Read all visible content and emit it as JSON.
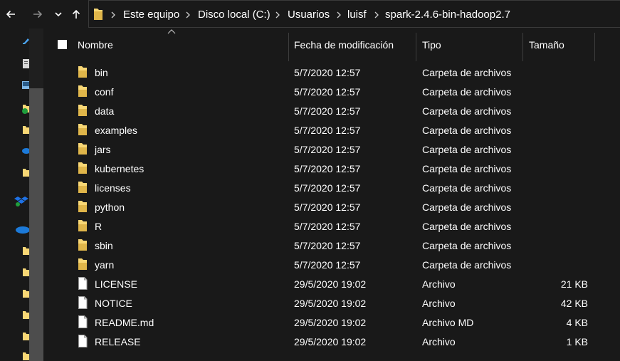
{
  "nav": {
    "back_icon": "arrow-left-icon",
    "forward_icon": "arrow-right-icon",
    "recent_icon": "chevron-down-icon",
    "up_icon": "arrow-up-icon"
  },
  "breadcrumb": [
    {
      "label": "Este equipo"
    },
    {
      "label": "Disco local (C:)"
    },
    {
      "label": "Usuarios"
    },
    {
      "label": "luisf"
    },
    {
      "label": "spark-2.4.6-bin-hadoop2.7"
    }
  ],
  "columns": {
    "name": "Nombre",
    "date": "Fecha de modificación",
    "type": "Tipo",
    "size": "Tamaño"
  },
  "files": [
    {
      "name": "bin",
      "date": "5/7/2020 12:57",
      "type": "Carpeta de archivos",
      "size": "",
      "kind": "folder"
    },
    {
      "name": "conf",
      "date": "5/7/2020 12:57",
      "type": "Carpeta de archivos",
      "size": "",
      "kind": "folder"
    },
    {
      "name": "data",
      "date": "5/7/2020 12:57",
      "type": "Carpeta de archivos",
      "size": "",
      "kind": "folder"
    },
    {
      "name": "examples",
      "date": "5/7/2020 12:57",
      "type": "Carpeta de archivos",
      "size": "",
      "kind": "folder"
    },
    {
      "name": "jars",
      "date": "5/7/2020 12:57",
      "type": "Carpeta de archivos",
      "size": "",
      "kind": "folder"
    },
    {
      "name": "kubernetes",
      "date": "5/7/2020 12:57",
      "type": "Carpeta de archivos",
      "size": "",
      "kind": "folder"
    },
    {
      "name": "licenses",
      "date": "5/7/2020 12:57",
      "type": "Carpeta de archivos",
      "size": "",
      "kind": "folder"
    },
    {
      "name": "python",
      "date": "5/7/2020 12:57",
      "type": "Carpeta de archivos",
      "size": "",
      "kind": "folder"
    },
    {
      "name": "R",
      "date": "5/7/2020 12:57",
      "type": "Carpeta de archivos",
      "size": "",
      "kind": "folder"
    },
    {
      "name": "sbin",
      "date": "5/7/2020 12:57",
      "type": "Carpeta de archivos",
      "size": "",
      "kind": "folder"
    },
    {
      "name": "yarn",
      "date": "5/7/2020 12:57",
      "type": "Carpeta de archivos",
      "size": "",
      "kind": "folder"
    },
    {
      "name": "LICENSE",
      "date": "29/5/2020 19:02",
      "type": "Archivo",
      "size": "21 KB",
      "kind": "file"
    },
    {
      "name": "NOTICE",
      "date": "29/5/2020 19:02",
      "type": "Archivo",
      "size": "42 KB",
      "kind": "file"
    },
    {
      "name": "README.md",
      "date": "29/5/2020 19:02",
      "type": "Archivo MD",
      "size": "4 KB",
      "kind": "file"
    },
    {
      "name": "RELEASE",
      "date": "29/5/2020 19:02",
      "type": "Archivo",
      "size": "1 KB",
      "kind": "file"
    }
  ],
  "colors": {
    "background": "#191919",
    "folder": "#f8d775",
    "folder_dark": "#e0b64a",
    "text": "#ffffff"
  }
}
